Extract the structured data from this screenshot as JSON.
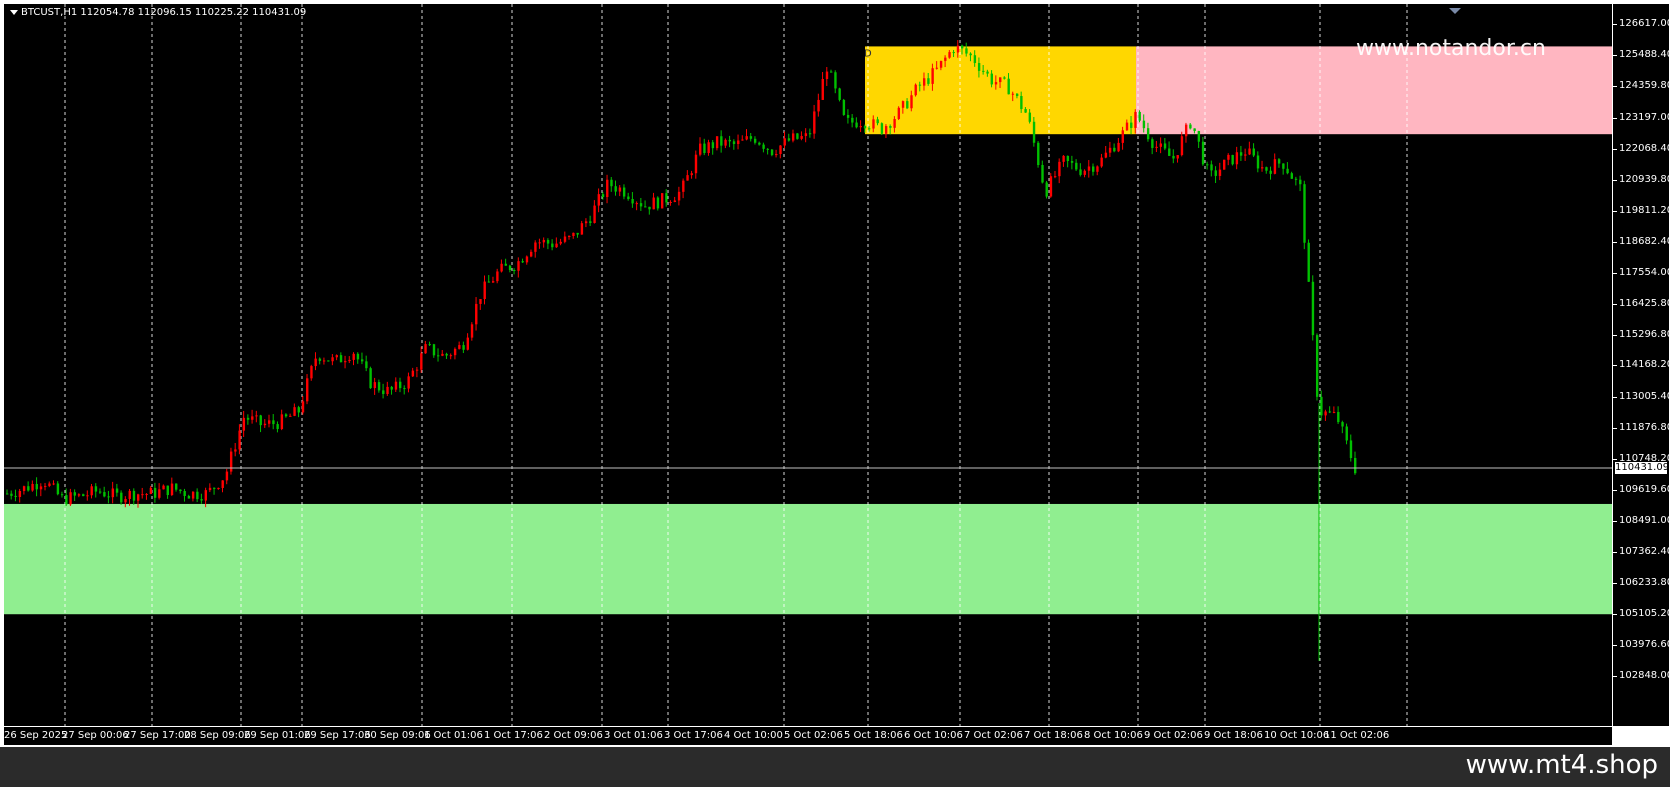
{
  "symbol_info": "BTCUST,H1  112054.78 112096.15 110225.22 110431.09",
  "watermark": "www.notandor.cn",
  "footer_watermark": "www.mt4.shop",
  "zone_label": "D",
  "current_price": "110431.09",
  "price_labels": [
    "126617.00",
    "125488.40",
    "124359.80",
    "123197.00",
    "122068.40",
    "120939.80",
    "119811.20",
    "118682.40",
    "117554.00",
    "116425.80",
    "115296.80",
    "114168.20",
    "113005.40",
    "111876.80",
    "110748.20",
    "109619.60",
    "108491.00",
    "107362.40",
    "106233.80",
    "105105.20",
    "103976.60",
    "102848.00"
  ],
  "time_labels": [
    "26 Sep 2025",
    "27 Sep 00:06",
    "27 Sep 17:00",
    "28 Sep 09:06",
    "29 Sep 01:06",
    "29 Sep 17:06",
    "30 Sep 09:06",
    "1 Oct 01:06",
    "1 Oct 17:06",
    "2 Oct 09:06",
    "3 Oct 01:06",
    "3 Oct 17:06",
    "4 Oct 10:00",
    "5 Oct 02:06",
    "5 Oct 18:06",
    "6 Oct 10:06",
    "7 Oct 02:06",
    "7 Oct 18:06",
    "8 Oct 10:06",
    "9 Oct 02:06",
    "9 Oct 18:06",
    "10 Oct 10:06",
    "11 Oct 02:06"
  ],
  "colors": {
    "bull": "#ff0000",
    "bear": "#00c000",
    "zone_supply": "#ffd700",
    "zone_supply_ext": "#ffb6c1",
    "zone_demand": "#90ee90",
    "grid": "#ffffff",
    "background": "#000000"
  },
  "chart_data": {
    "type": "candlestick",
    "y_range": [
      102848.0,
      126617.0
    ],
    "price_path": [
      109500,
      109700,
      110000,
      109300,
      109400,
      109600,
      109400,
      109500,
      109500,
      109700,
      109500,
      109500,
      110200,
      112300,
      112000,
      112100,
      112500,
      114600,
      114300,
      114700,
      113500,
      113200,
      113600,
      114800,
      114500,
      114900,
      116800,
      117600,
      117900,
      118700,
      118600,
      118800,
      119600,
      120800,
      120500,
      120000,
      120200,
      120500,
      122000,
      122300,
      122200,
      122500,
      122000,
      122400,
      122500,
      125100,
      123000,
      123100,
      122800,
      123400,
      124300,
      124900,
      125800,
      125400,
      124600,
      124300,
      123300,
      120500,
      121600,
      121300,
      121600,
      122400,
      123300,
      122200,
      121700,
      123100,
      121000,
      121600,
      122000,
      121300,
      121600,
      120600,
      112500,
      112300,
      110431
    ],
    "zones": {
      "supply": {
        "price_top": 125800,
        "price_bottom": 122600
      },
      "demand": {
        "price_top": 109120,
        "price_bottom": 105100
      }
    }
  }
}
